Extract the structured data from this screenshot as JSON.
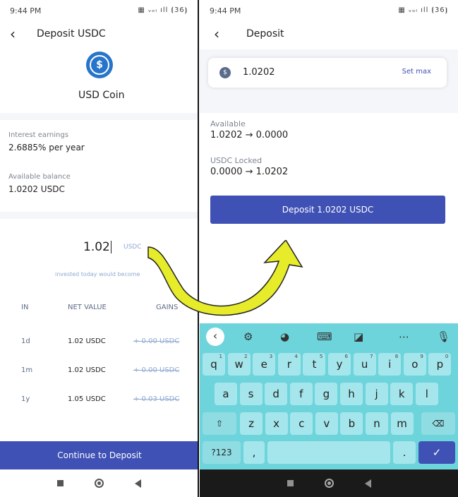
{
  "left": {
    "status": {
      "time": "9:44 PM",
      "icons": "▦ ᵥₒₗ ıll ⦗36⦘"
    },
    "title": "Deposit USDC",
    "coin_name": "USD Coin",
    "interest_label": "Interest earnings",
    "interest_value": "2.6885% per year",
    "balance_label": "Available balance",
    "balance_value": "1.0202 USDC",
    "amount": "1.02",
    "amount_unit": "USDC",
    "hint": "invested today would become",
    "table": {
      "headers": [
        "IN",
        "NET VALUE",
        "GAINS"
      ],
      "rows": [
        {
          "in": "1d",
          "net": "1.02 USDC",
          "gain": "+ 0.00 USDC"
        },
        {
          "in": "1m",
          "net": "1.02 USDC",
          "gain": "+ 0.00 USDC"
        },
        {
          "in": "1y",
          "net": "1.05 USDC",
          "gain": "+ 0.03 USDC"
        }
      ]
    },
    "continue_label": "Continue to Deposit"
  },
  "right": {
    "status": {
      "time": "9:44 PM",
      "icons": "▦ ᵥₒₗ ıll ⦗36⦘"
    },
    "title": "Deposit",
    "amount": "1.0202",
    "set_max": "Set max",
    "available_label": "Available",
    "available_value": "1.0202 → 0.0000",
    "locked_label": "USDC Locked",
    "locked_value": "0.0000 → 1.0202",
    "deposit_label": "Deposit 1.0202 USDC",
    "keyboard": {
      "row1": [
        [
          "q",
          "1"
        ],
        [
          "w",
          "2"
        ],
        [
          "e",
          "3"
        ],
        [
          "r",
          "4"
        ],
        [
          "t",
          "5"
        ],
        [
          "y",
          "6"
        ],
        [
          "u",
          "7"
        ],
        [
          "i",
          "8"
        ],
        [
          "o",
          "9"
        ],
        [
          "p",
          "0"
        ]
      ],
      "row2": [
        "a",
        "s",
        "d",
        "f",
        "g",
        "h",
        "j",
        "k",
        "l"
      ],
      "row3": [
        "z",
        "x",
        "c",
        "v",
        "b",
        "n",
        "m"
      ],
      "symbols_key": "?123",
      "comma_key": ","
    }
  },
  "colors": {
    "accent": "#3f51b5",
    "usdc": "#2775ca",
    "keyboard": "#6dd4dc",
    "arrow": "#e6ec2a"
  }
}
